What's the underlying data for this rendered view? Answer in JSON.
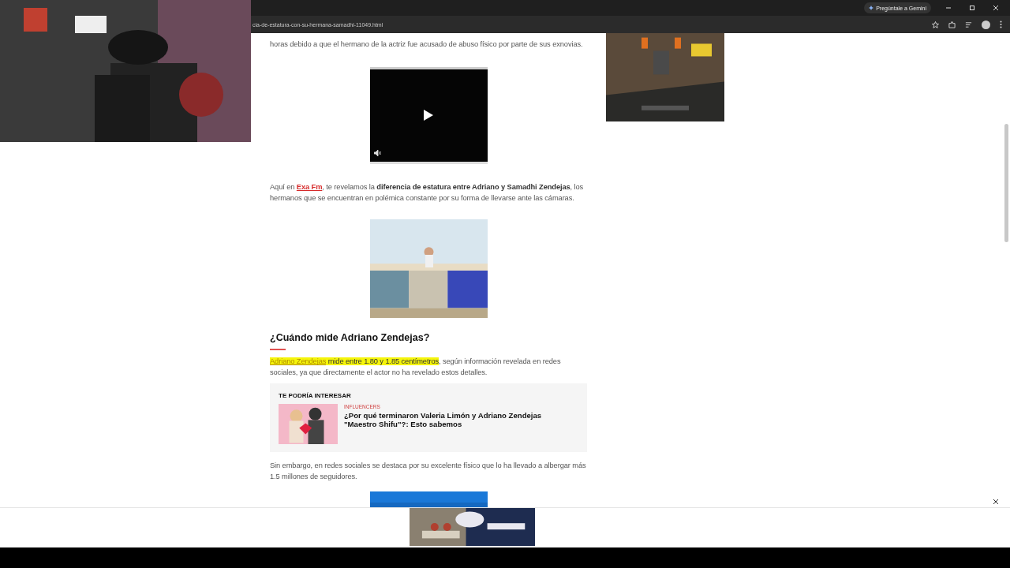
{
  "browser": {
    "url": "cia-de-estatura-con-su-hermana-samadhi-11049.html",
    "gemini_button": "Pregúntale a Gemini"
  },
  "article": {
    "paragraphs_top": [
      [
        {
          "kind": "plain",
          "text": "horas debido a que el hermano de la actriz fue acusado de abuso físico por parte de sus exnovias."
        }
      ],
      [
        {
          "kind": "plain",
          "text": "Aquí en "
        },
        {
          "kind": "link",
          "text": "Exa Fm"
        },
        {
          "kind": "plain",
          "text": ", te revelamos la "
        },
        {
          "kind": "bold",
          "text": "diferencia de estatura entre Adriano y Samadhi Zendejas"
        },
        {
          "kind": "plain",
          "text": ", los hermanos que se encuentran en polémica constante por su forma de llevarse ante las cámaras."
        }
      ]
    ],
    "heading": "¿Cuándo mide Adriano Zendejas?",
    "paragraphs_mid": [
      [
        {
          "kind": "highlight-link",
          "text": "Adriano Zendejas"
        },
        {
          "kind": "highlight",
          "text": " mide entre 1.80 y 1.85 centímetros"
        },
        {
          "kind": "plain",
          "text": ", según información revelada en redes sociales, ya que directamente el actor no ha revelado estos detalles."
        }
      ]
    ],
    "related": {
      "label": "TE PODRÍA INTERESAR",
      "category": "INFLUENCERS",
      "title": "¿Por qué terminaron Valeria Limón y Adriano Zendejas \"Maestro Shifu\"?: Esto sabemos"
    },
    "paragraphs_end": [
      [
        {
          "kind": "plain",
          "text": "Sin embargo, en redes sociales se destaca por su excelente físico que lo ha llevado a albergar más 1.5 millones de seguidores."
        }
      ]
    ]
  }
}
